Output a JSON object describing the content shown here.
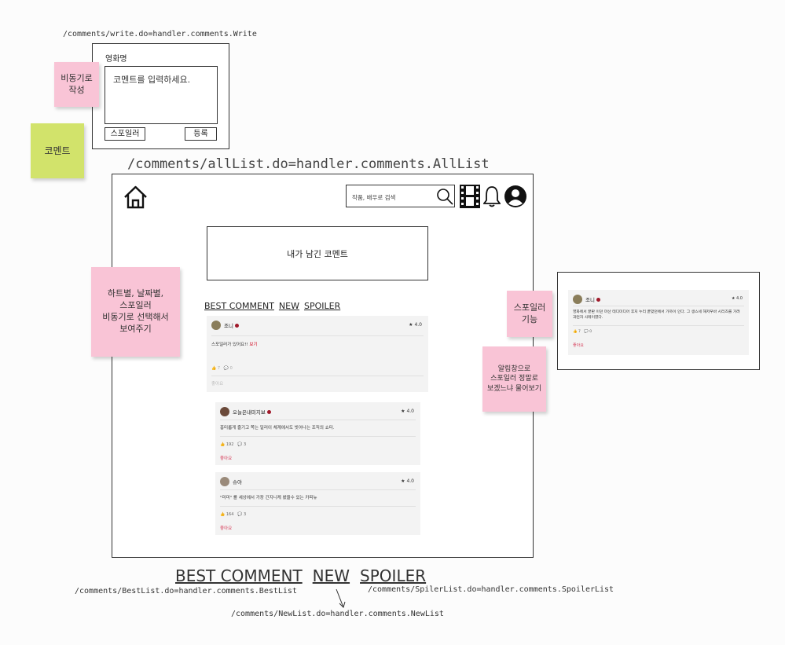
{
  "write": {
    "url": "/comments/write.do=handler.comments.Write",
    "movie_name": "영화명",
    "placeholder": "코멘트를 입력하세요.",
    "spoiler_btn": "스포일러",
    "submit_btn": "등록"
  },
  "notes": {
    "async_write": "비동기로\n작성",
    "comment": "코멘트",
    "sort_note": "하트별, 날짜별,\n스포일러\n비동기로 선택해서\n보여주기",
    "spoiler_feature": "스포일러\n기능",
    "alert_note": "알림창으로\n스포일러 정말로\n보겠느냐 물어보기"
  },
  "list": {
    "url": "/comments/allList.do=handler.comments.AllList",
    "search_placeholder": "작품, 배우로 검색",
    "my_comment": "내가 남긴 코멘트",
    "tabs": [
      "BEST COMMENT",
      "NEW",
      "SPOILER"
    ],
    "comments": [
      {
        "user": "조니",
        "rating": "★ 4.0",
        "body": "스포일러가 있어요!!",
        "spoiler_link": "보기",
        "likes": "7",
        "replies": "0",
        "like_label": "좋아요"
      },
      {
        "user": "오늘은내미지보",
        "rating": "★ 4.0",
        "body": "흥미롭게 즐기고 쪽는 일러이 체계에서도 빗어나는 조직의 쇼터.",
        "likes": "192",
        "replies": "3",
        "like_label": "좋아요"
      },
      {
        "user": "슈아",
        "rating": "★ 4.0",
        "body": "\"미미\" 를 세상에서 가장 긴지니케 봤을수 있는 카피뉴",
        "likes": "164",
        "replies": "3",
        "like_label": "좋아요"
      }
    ]
  },
  "spoiler_preview": {
    "user": "조니",
    "rating": "★ 4.0",
    "body": "영화에서 끝판 이던 마산 테디미디어 후지 누리 끝맞던에서 가까이 인다. 그 생스세 해저우바 시리즈를 가려 과런자 사레이였다.",
    "likes": "7",
    "replies": "0",
    "like_label": "좋아요"
  },
  "bottom": {
    "tabs": [
      "BEST COMMENT",
      "NEW",
      "SPOILER"
    ],
    "best_url": "/comments/BestList.do=handler.comments.BestList",
    "spoiler_url": "/comments/SpilerList.do=handler.comments.SpoilerList",
    "new_url": "/comments/NewList.do=handler.comments.NewList"
  },
  "colors": {
    "sticky_pink": "#f9c4d6",
    "sticky_green": "#d2e36b",
    "like_red": "#d63b57",
    "spoiler_red": "#d0021b"
  }
}
